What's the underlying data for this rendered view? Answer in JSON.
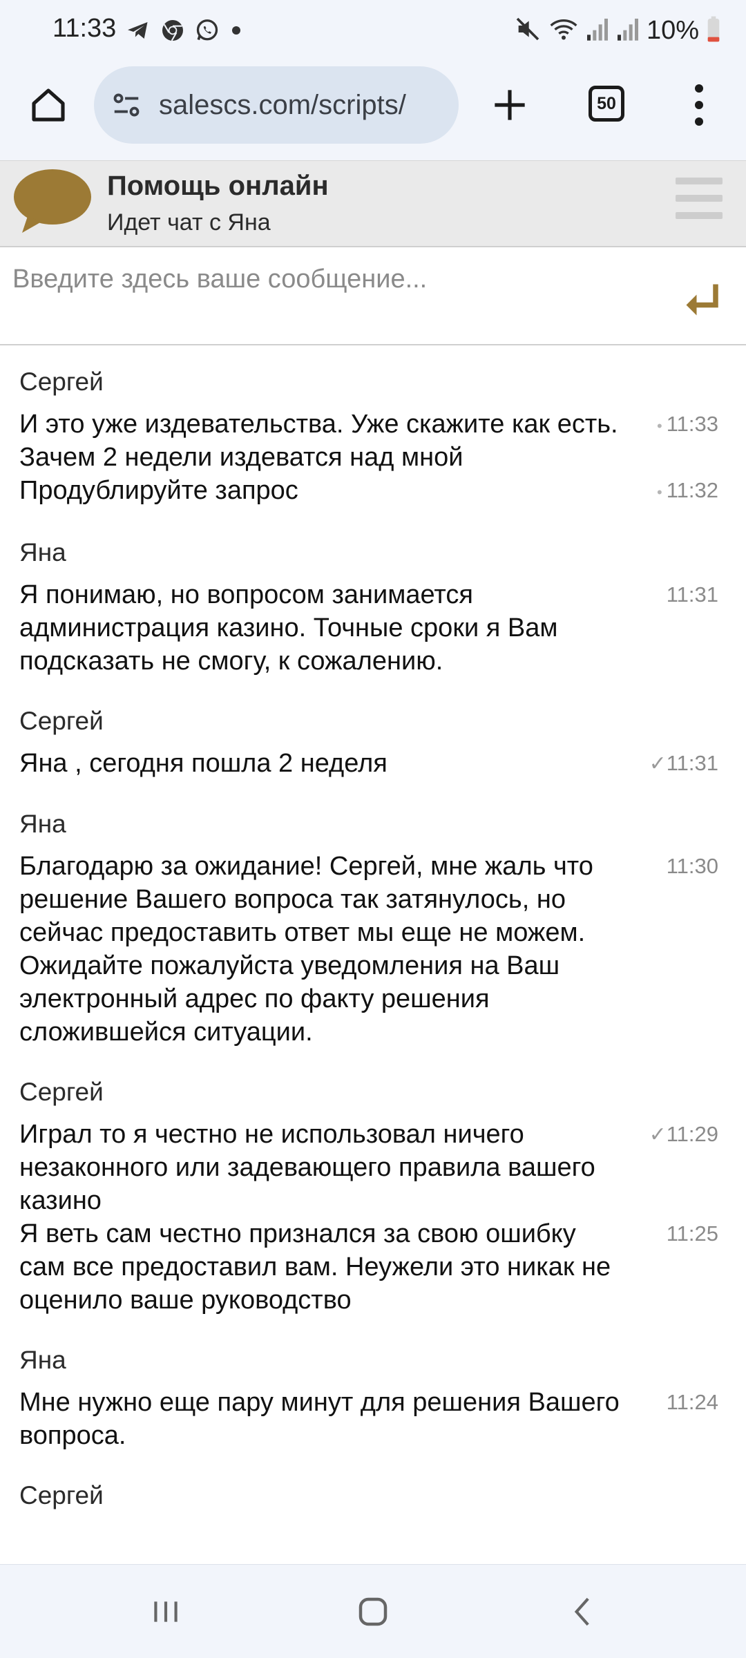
{
  "status_bar": {
    "time": "11:33",
    "left_icons": [
      "telegram-icon",
      "chrome-icon",
      "whatsapp-icon",
      "dot-icon"
    ],
    "right_icons": [
      "mute-icon",
      "wifi-icon",
      "signal-icon",
      "signal-icon"
    ],
    "battery_percent": "10%"
  },
  "browser": {
    "url": "salescs.com/scripts/",
    "tab_count": "50"
  },
  "chat_header": {
    "title": "Помощь онлайн",
    "subtitle": "Идет чат с Яна"
  },
  "input": {
    "placeholder": "Введите здесь ваше сообщение..."
  },
  "messages": [
    {
      "sender": "Сергей",
      "items": [
        {
          "text": "И это уже издевательства.  Уже скажите как есть. Зачем 2 недели издеватся над мной",
          "time": "11:33",
          "status": "pending"
        },
        {
          "text": "Продублируйте запрос",
          "time": "11:32",
          "status": "pending"
        }
      ]
    },
    {
      "sender": "Яна",
      "items": [
        {
          "text": "Я понимаю, но вопросом занимается администрация казино. Точные сроки я Вам подсказать не смогу, к сожалению.",
          "time": "11:31",
          "status": "none"
        }
      ]
    },
    {
      "sender": "Сергей",
      "items": [
        {
          "text": "Яна , сегодня пошла 2 неделя",
          "time": "11:31",
          "status": "read"
        }
      ]
    },
    {
      "sender": "Яна",
      "items": [
        {
          "text": "Благодарю за ожидание! Сергей, мне жаль что решение Вашего вопроса так затянулось, но сейчас предоставить ответ мы еще не можем. Ожидайте пожалуйста уведомления на Ваш электронный адрес по факту решения сложившейся ситуации.",
          "time": "11:30",
          "status": "none"
        }
      ]
    },
    {
      "sender": "Сергей",
      "items": [
        {
          "text": "Играл то я честно не использовал ничего незаконного или задевающего правила вашего казино",
          "time": "11:29",
          "status": "read"
        },
        {
          "text": "Я веть сам честно признался за свою ошибку сам все предоставил вам. Неужели это никак не оценило ваше руководство",
          "time": "11:25",
          "status": "none"
        }
      ]
    },
    {
      "sender": "Яна",
      "items": [
        {
          "text": "Мне нужно еще пару минут для решения Вашего вопроса.",
          "time": "11:24",
          "status": "none"
        }
      ]
    },
    {
      "sender": "Сергей",
      "items": []
    }
  ],
  "colors": {
    "accent": "#9c7a35",
    "chrome_bg": "#f2f5fb",
    "url_pill": "#dbe4f0",
    "header_bg": "#eaeaea"
  }
}
